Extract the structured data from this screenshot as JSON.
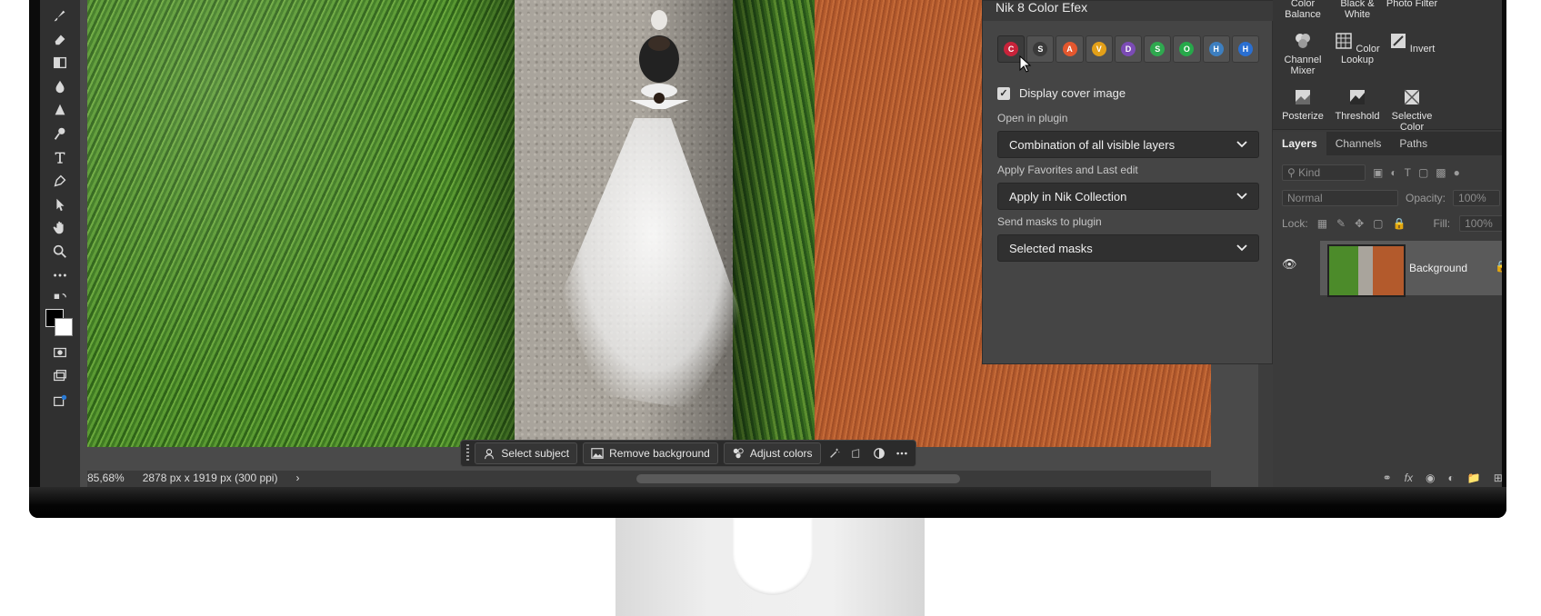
{
  "nik_panel": {
    "title": "Nik 8 Color Efex",
    "plugins": [
      {
        "letter": "C",
        "color": "#c8233a"
      },
      {
        "letter": "S",
        "color": "#3a3a3a"
      },
      {
        "letter": "A",
        "color": "#e4572e"
      },
      {
        "letter": "V",
        "color": "#e3a019"
      },
      {
        "letter": "D",
        "color": "#7b4bb5"
      },
      {
        "letter": "S",
        "color": "#2fa84f"
      },
      {
        "letter": "O",
        "color": "#27a84a"
      },
      {
        "letter": "H",
        "color": "#3d7fc0"
      },
      {
        "letter": "H",
        "color": "#2a6fd1"
      }
    ],
    "display_cover_label": "Display cover image",
    "open_label": "Open in plugin",
    "open_value": "Combination of all visible layers",
    "favorites_label": "Apply Favorites and Last edit",
    "favorites_value": "Apply in Nik Collection",
    "masks_label": "Send masks to plugin",
    "masks_value": "Selected masks"
  },
  "taskbar": {
    "select_subject": "Select subject",
    "remove_background": "Remove background",
    "adjust_colors": "Adjust colors"
  },
  "status": {
    "zoom": "85,68%",
    "doc_size": "2878 px x 1919 px (300 ppi)"
  },
  "adjustments": [
    {
      "label": "Color Balance"
    },
    {
      "label": "Black & White"
    },
    {
      "label": "Photo Filter"
    },
    {
      "label": "Channel Mixer"
    },
    {
      "label": "Color Lookup"
    },
    {
      "label": "Invert"
    },
    {
      "label": "Posterize"
    },
    {
      "label": "Threshold"
    },
    {
      "label": "Selective Color"
    }
  ],
  "layers": {
    "tabs": [
      "Layers",
      "Channels",
      "Paths"
    ],
    "filter_placeholder": "Kind",
    "blend_mode": "Normal",
    "opacity_label": "Opacity:",
    "opacity_value": "100%",
    "lock_label": "Lock:",
    "fill_label": "Fill:",
    "fill_value": "100%",
    "layer_name": "Background"
  }
}
